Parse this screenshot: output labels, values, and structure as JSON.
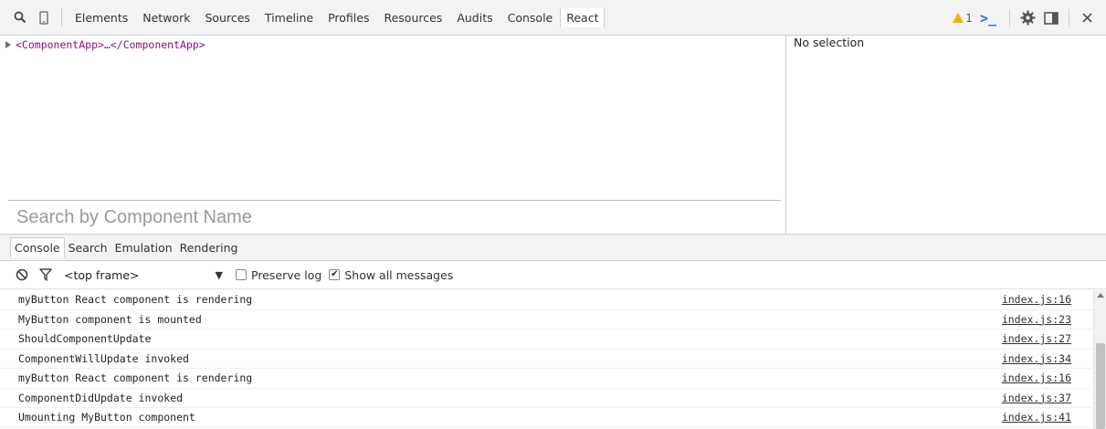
{
  "toolbar": {
    "tabs": [
      "Elements",
      "Network",
      "Sources",
      "Timeline",
      "Profiles",
      "Resources",
      "Audits",
      "Console",
      "React"
    ],
    "active_tab": "React",
    "warning_count": "1",
    "icons": [
      "search-icon",
      "device-mode-icon",
      "warning-icon",
      "console-drawer-icon",
      "settings-gear-icon",
      "dock-icon",
      "close-icon"
    ]
  },
  "elements": {
    "tree_root": "<ComponentApp>…</ComponentApp>",
    "search_placeholder": "Search by Component Name"
  },
  "sidebar": {
    "status": "No selection"
  },
  "drawer": {
    "tabs": [
      "Console",
      "Search",
      "Emulation",
      "Rendering"
    ],
    "active_tab": "Console"
  },
  "console": {
    "frame": "<top frame>",
    "preserve_log": {
      "label": "Preserve log",
      "checked": false
    },
    "show_all": {
      "label": "Show all messages",
      "checked": true
    },
    "messages": [
      {
        "text": "myButton React component is rendering",
        "source": "index.js:16"
      },
      {
        "text": "MyButton component is mounted",
        "source": "index.js:23"
      },
      {
        "text": "ShouldComponentUpdate",
        "source": "index.js:27"
      },
      {
        "text": "ComponentWillUpdate invoked",
        "source": "index.js:34"
      },
      {
        "text": "myButton React component is rendering",
        "source": "index.js:16"
      },
      {
        "text": "ComponentDidUpdate invoked",
        "source": "index.js:37"
      },
      {
        "text": "Umounting MyButton component",
        "source": "index.js:41"
      }
    ]
  },
  "colors": {
    "tag": "#881280",
    "warning": "#f4b400",
    "drawer_icon": "#1a73e8"
  }
}
